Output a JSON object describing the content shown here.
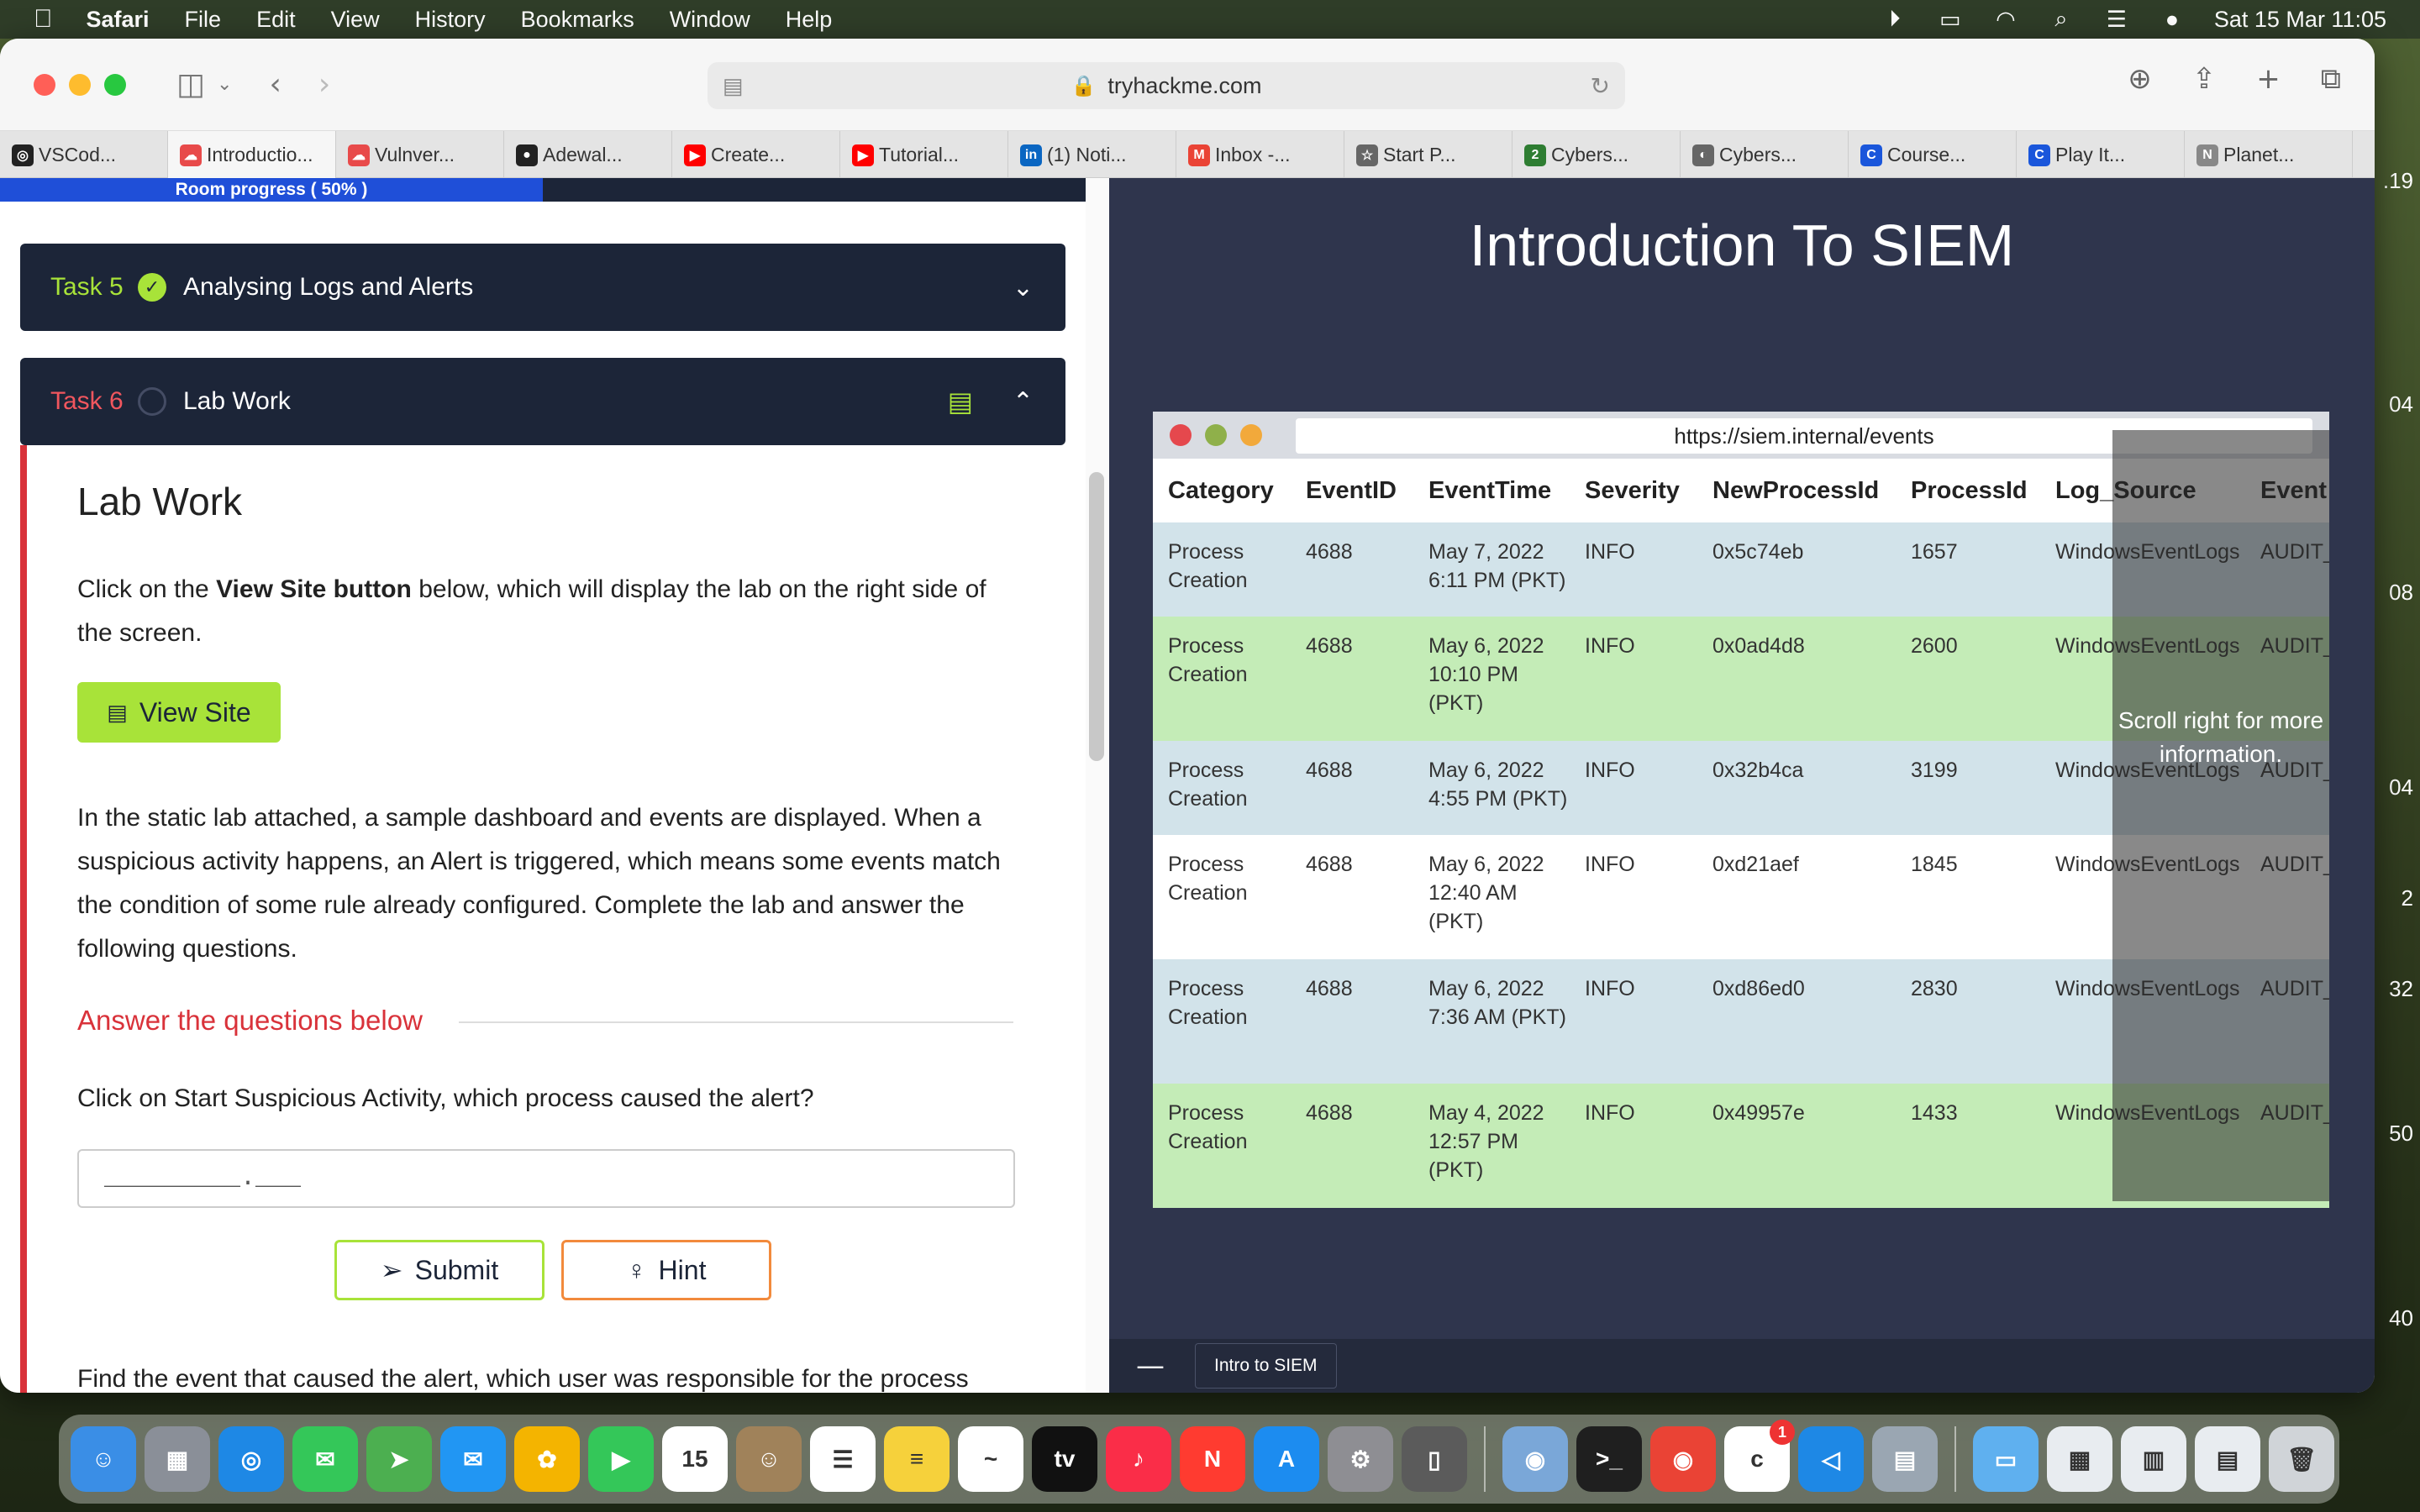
{
  "menubar": {
    "app": "Safari",
    "items": [
      "File",
      "Edit",
      "View",
      "History",
      "Bookmarks",
      "Window",
      "Help"
    ],
    "clock": "Sat 15 Mar  11:05"
  },
  "browser": {
    "url": "tryhackme.com",
    "tabs": [
      {
        "label": "VSCod...",
        "color": "#222222",
        "glyph": "◎"
      },
      {
        "label": "Introductio...",
        "color": "#e84a4a",
        "glyph": "☁"
      },
      {
        "label": "Vulnver...",
        "color": "#e84a4a",
        "glyph": "☁"
      },
      {
        "label": "Adewal...",
        "color": "#222222",
        "glyph": "●"
      },
      {
        "label": "Create...",
        "color": "#ff0000",
        "glyph": "▶"
      },
      {
        "label": "Tutorial...",
        "color": "#ff0000",
        "glyph": "▶"
      },
      {
        "label": "(1) Noti...",
        "color": "#0a66c2",
        "glyph": "in"
      },
      {
        "label": "Inbox -...",
        "color": "#ea4335",
        "glyph": "M"
      },
      {
        "label": "Start P...",
        "color": "#666666",
        "glyph": "☆"
      },
      {
        "label": "Cybers...",
        "color": "#2e7d32",
        "glyph": "2"
      },
      {
        "label": "Cybers...",
        "color": "#666666",
        "glyph": "◐"
      },
      {
        "label": "Course...",
        "color": "#1a56db",
        "glyph": "C"
      },
      {
        "label": "Play It...",
        "color": "#1a56db",
        "glyph": "C"
      },
      {
        "label": "Planet...",
        "color": "#888888",
        "glyph": "N"
      }
    ]
  },
  "room": {
    "progress_label": "Room progress ( 50% )",
    "progress": 0.5,
    "task5": {
      "num": "Task 5",
      "title": "Analysing Logs and Alerts"
    },
    "task6": {
      "num": "Task 6",
      "title": "Lab Work"
    },
    "heading": "Lab Work",
    "intro_prefix": "Click on the ",
    "intro_bold": "View Site button",
    "intro_suffix": " below, which will display the lab on the right side of the screen.",
    "view_site": "View Site",
    "description": "In the static lab attached, a sample dashboard and events are displayed. When a suspicious activity happens, an Alert is triggered, which means some events match the condition of some rule already configured. Complete the lab and answer the following questions.",
    "answer_title": "Answer the questions below",
    "question1": "Click on Start Suspicious Activity, which process caused the alert?",
    "answer_placeholder": "_________.___",
    "submit": "Submit",
    "hint": "Hint",
    "question2": "Find the event that caused the alert, which user was responsible for the process execution?"
  },
  "lab": {
    "title": "Introduction To SIEM",
    "url": "https://siem.internal/events",
    "columns": [
      "Category",
      "EventID",
      "EventTime",
      "Severity",
      "NewProcessId",
      "ProcessId",
      "Log_Source",
      "Event"
    ],
    "rows": [
      {
        "style": "blue",
        "cells": [
          "Process Creation",
          "4688",
          "May 7, 2022 6:11 PM (PKT)",
          "INFO",
          "0x5c74eb",
          "1657",
          "WindowsEventLogs",
          "AUDIT_"
        ]
      },
      {
        "style": "green",
        "cells": [
          "Process Creation",
          "4688",
          "May 6, 2022 10:10 PM (PKT)",
          "INFO",
          "0x0ad4d8",
          "2600",
          "WindowsEventLogs",
          "AUDIT_"
        ]
      },
      {
        "style": "blue",
        "cells": [
          "Process Creation",
          "4688",
          "May 6, 2022 4:55 PM (PKT)",
          "INFO",
          "0x32b4ca",
          "3199",
          "WindowsEventLogs",
          "AUDIT_"
        ]
      },
      {
        "style": "white",
        "cells": [
          "Process Creation",
          "4688",
          "May 6, 2022 12:40 AM (PKT)",
          "INFO",
          "0xd21aef",
          "1845",
          "WindowsEventLogs",
          "AUDIT_"
        ]
      },
      {
        "style": "blue",
        "cells": [
          "Process Creation",
          "4688",
          "May 6, 2022 7:36 AM (PKT)",
          "INFO",
          "0xd86ed0",
          "2830",
          "WindowsEventLogs",
          "AUDIT_"
        ]
      },
      {
        "style": "green",
        "cells": [
          "Process Creation",
          "4688",
          "May 4, 2022 12:57 PM (PKT)",
          "INFO",
          "0x49957e",
          "1433",
          "WindowsEventLogs",
          "AUDIT_"
        ]
      }
    ],
    "scroll_hint": "Scroll right for more information.",
    "footer_tab": "Intro to SIEM"
  },
  "desktop": {
    "edge_numbers": [
      ".19",
      "04",
      "08",
      "04",
      "2",
      "32",
      "50",
      "40"
    ]
  },
  "dock": {
    "apps": [
      {
        "name": "finder-icon",
        "color": "#3a8ee6",
        "glyph": "☺"
      },
      {
        "name": "launchpad-icon",
        "color": "#8a8f98",
        "glyph": "▦"
      },
      {
        "name": "safari-icon",
        "color": "#1e88e5",
        "glyph": "◎"
      },
      {
        "name": "messages-icon",
        "color": "#34c759",
        "glyph": "✉"
      },
      {
        "name": "maps-icon",
        "color": "#4caf50",
        "glyph": "➤"
      },
      {
        "name": "mail-icon",
        "color": "#2196f3",
        "glyph": "✉"
      },
      {
        "name": "photos-icon",
        "color": "#f4b400",
        "glyph": "✿"
      },
      {
        "name": "facetime-icon",
        "color": "#34c759",
        "glyph": "▶"
      },
      {
        "name": "calendar-icon",
        "color": "#ffffff",
        "glyph": "15"
      },
      {
        "name": "contacts-icon",
        "color": "#a0825a",
        "glyph": "☺"
      },
      {
        "name": "reminders-icon",
        "color": "#ffffff",
        "glyph": "☰"
      },
      {
        "name": "notes-icon",
        "color": "#f6d13b",
        "glyph": "≡"
      },
      {
        "name": "freeform-icon",
        "color": "#ffffff",
        "glyph": "~"
      },
      {
        "name": "apple-tv-icon",
        "color": "#111111",
        "glyph": "tv"
      },
      {
        "name": "music-icon",
        "color": "#fa2d48",
        "glyph": "♪"
      },
      {
        "name": "news-icon",
        "color": "#ff3b30",
        "glyph": "N"
      },
      {
        "name": "app-store-icon",
        "color": "#1c8cf0",
        "glyph": "A"
      },
      {
        "name": "system-settings-icon",
        "color": "#8e8e93",
        "glyph": "⚙"
      },
      {
        "name": "iphone-mirroring-icon",
        "color": "#5b5b5b",
        "glyph": "▯"
      },
      {
        "name": "preview-icon",
        "color": "#7aa7d8",
        "glyph": "◉"
      },
      {
        "name": "terminal-icon",
        "color": "#1f1f1f",
        "glyph": ">_"
      },
      {
        "name": "chrome-icon",
        "color": "#ea4335",
        "glyph": "◉"
      },
      {
        "name": "cricut-icon",
        "color": "#ffffff",
        "glyph": "c",
        "badge": "1"
      },
      {
        "name": "vscode-icon",
        "color": "#1e88e5",
        "glyph": "◁"
      },
      {
        "name": "app-icon",
        "color": "#9aa6b2",
        "glyph": "▤"
      },
      {
        "name": "folder-icon",
        "color": "#5fb0ef",
        "glyph": "▭"
      },
      {
        "name": "window-thumb-icon",
        "color": "#e8ecf0",
        "glyph": "▦"
      },
      {
        "name": "window-thumb-icon",
        "color": "#e8ecf0",
        "glyph": "▥"
      },
      {
        "name": "window-thumb-icon",
        "color": "#e8ecf0",
        "glyph": "▤"
      },
      {
        "name": "trash-icon",
        "color": "#d0d4d8",
        "glyph": "🗑"
      }
    ]
  }
}
